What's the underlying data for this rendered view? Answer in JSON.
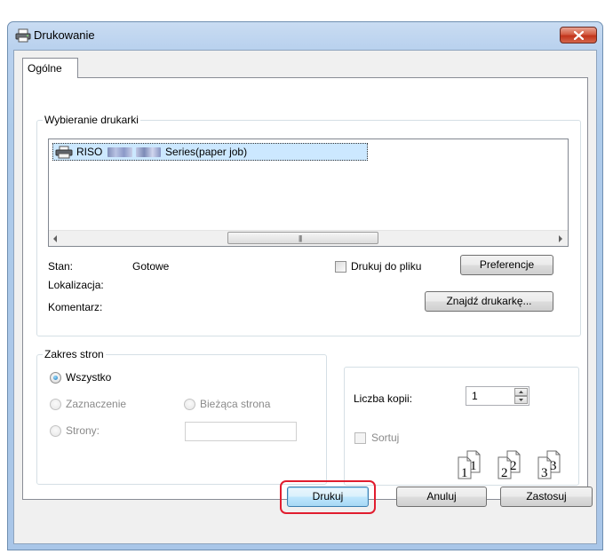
{
  "window": {
    "title": "Drukowanie"
  },
  "tabs": [
    {
      "label": "Ogólne"
    }
  ],
  "printer_section": {
    "label": "Wybieranie drukarki",
    "printer_prefix": "RISO",
    "printer_suffix": "Series(paper job)",
    "status_label": "Stan:",
    "status_value": "Gotowe",
    "location_label": "Lokalizacja:",
    "comment_label": "Komentarz:",
    "print_to_file_label": "Drukuj do pliku",
    "preferences_button": "Preferencje",
    "find_printer_button": "Znajdź drukarkę..."
  },
  "range_section": {
    "label": "Zakres stron",
    "all": "Wszystko",
    "selection": "Zaznaczenie",
    "current_page": "Bieżąca strona",
    "pages": "Strony:"
  },
  "copies_section": {
    "copies_label": "Liczba kopii:",
    "copies_value": "1",
    "collate_label": "Sortuj",
    "collate_pages": [
      "1",
      "1",
      "2",
      "2",
      "3",
      "3"
    ]
  },
  "buttons": {
    "print": "Drukuj",
    "cancel": "Anuluj",
    "apply": "Zastosuj"
  },
  "colors": {
    "highlight": "#e11d2f",
    "selection": "#cce8ff",
    "close": "#c7462b"
  },
  "icons": [
    "printer-icon",
    "close-icon",
    "scroll-left-icon",
    "scroll-right-icon",
    "spin-up-icon",
    "spin-down-icon",
    "collate-icon"
  ]
}
